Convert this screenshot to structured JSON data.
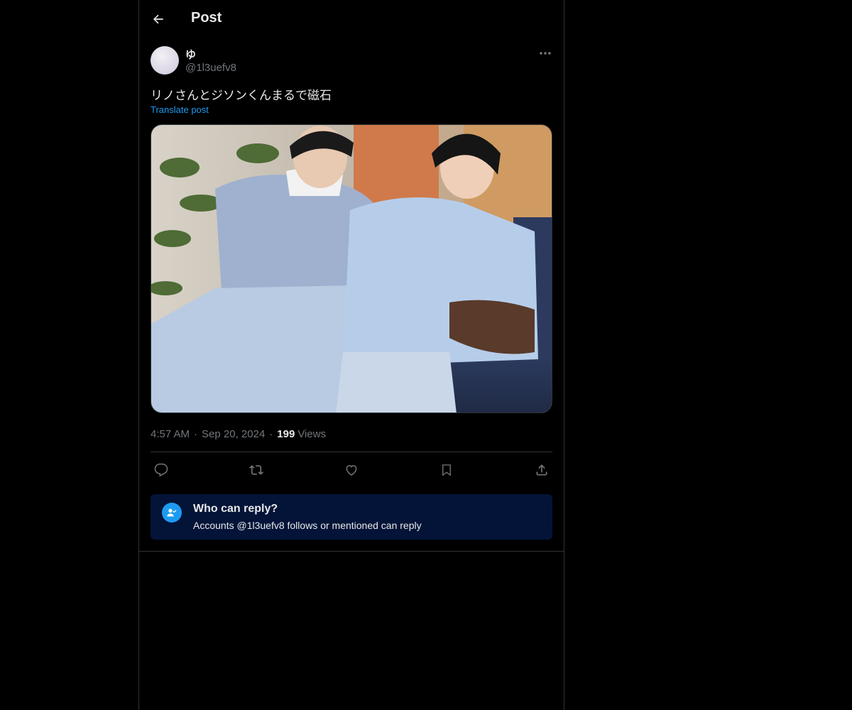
{
  "header": {
    "title": "Post",
    "back_icon": "arrow-left-icon"
  },
  "post": {
    "author": {
      "display_name": "ゆ",
      "handle": "@1l3uefv8"
    },
    "text": "リノさんとジソンくんまるで磁石",
    "translate_label": "Translate post",
    "timestamp": {
      "time": "4:57 AM",
      "date": "Sep 20, 2024",
      "separator": "·"
    },
    "views": {
      "count": "199",
      "label": "Views"
    },
    "actions": [
      {
        "icon": "reply-icon"
      },
      {
        "icon": "repost-icon"
      },
      {
        "icon": "like-icon"
      },
      {
        "icon": "bookmark-icon"
      },
      {
        "icon": "share-icon"
      }
    ]
  },
  "reply_settings": {
    "title": "Who can reply?",
    "description": "Accounts @1l3uefv8 follows or mentioned can reply",
    "icon": "person-check-icon"
  },
  "colors": {
    "background": "#000000",
    "text_primary": "#e7e9ea",
    "text_secondary": "#71767b",
    "accent": "#1d9bf0",
    "reply_box_bg": "#031438",
    "border": "#2f3336"
  }
}
